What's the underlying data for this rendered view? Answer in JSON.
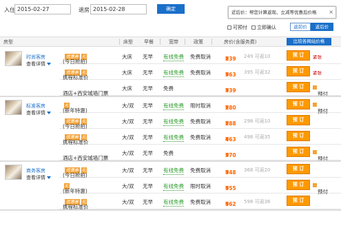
{
  "search": {
    "checkin_label": "入住",
    "checkin_value": "2015-02-27",
    "checkout_label": "退房",
    "checkout_value": "2015-02-28",
    "confirm_label": "确定"
  },
  "notice": {
    "text": "近后价：帮您计算返现、立减等优惠后价格",
    "close": "×"
  },
  "filters": {
    "prepay_label": "可预付",
    "instant_label": "立即确认"
  },
  "sort": {
    "after_label": "返后价",
    "before_label": "返前价"
  },
  "headers": {
    "room": "房型",
    "bed": "床型",
    "breakfast": "早餐",
    "broadband": "宽带",
    "policy": "政策",
    "price": "房价(含服务费)",
    "compare": "比较各网站价格"
  },
  "rooms": [
    {
      "name": "时尚客房",
      "more": "查看详情",
      "rates": [
        {
          "name": "(今日抢拍)",
          "tag": "优惠券",
          "tag2": "礼",
          "bed": "大床",
          "breakfast": "无早",
          "net": "有线免费",
          "net_free": true,
          "policy": "免费取消",
          "price": "239",
          "orig": "249 可返10",
          "book": "预 订",
          "note": "紧张"
        },
        {
          "name": "携程标准价",
          "tag": "优惠券",
          "tag2": "礼",
          "bed": "大床",
          "breakfast": "无早",
          "net": "有线免费",
          "net_free": true,
          "policy": "免费取消",
          "price": "363",
          "orig": "395 可返32",
          "book": "预 订",
          "note": "紧张"
        },
        {
          "name": "酒店+西安城墙门票",
          "tag": "",
          "tag2": "",
          "bed": "大床",
          "breakfast": "无早",
          "net": "免费",
          "net_free": false,
          "policy": "",
          "price": "339",
          "orig": "",
          "book": "预 订",
          "note": "",
          "pay": "预付"
        }
      ]
    },
    {
      "name": "标准客房",
      "more": "查看详情",
      "rates": [
        {
          "name": "(新年特惠)",
          "tag": "",
          "tag2": "礼",
          "bed": "大/双",
          "breakfast": "无早",
          "net": "有线免费",
          "net_free": true,
          "policy": "限时取消",
          "price": "280",
          "orig": "",
          "book": "预 订",
          "note": "",
          "pay": "预付"
        },
        {
          "name": "(今日抢拍)",
          "tag": "优惠券",
          "tag2": "礼",
          "bed": "大/双",
          "breakfast": "无早",
          "net": "有线免费",
          "net_free": true,
          "policy": "免费取消",
          "price": "288",
          "orig": "298 可返10",
          "book": "预 订",
          "note": ""
        },
        {
          "name": "携程标准价",
          "tag": "优惠券",
          "tag2": "礼",
          "bed": "大/双",
          "breakfast": "无早",
          "net": "有线免费",
          "net_free": true,
          "policy": "免费取消",
          "price": "463",
          "orig": "498 可返35",
          "book": "预 订",
          "note": ""
        },
        {
          "name": "酒店+西安城墙门票",
          "tag": "",
          "tag2": "",
          "bed": "大/双",
          "breakfast": "无早",
          "net": "免费",
          "net_free": false,
          "policy": "",
          "price": "370",
          "orig": "",
          "book": "预 订",
          "note": "",
          "pay": "预付"
        }
      ]
    },
    {
      "name": "商务客房",
      "more": "查看详情",
      "rates": [
        {
          "name": "(今日抢拍)",
          "tag": "优惠券",
          "tag2": "礼",
          "bed": "大/双",
          "breakfast": "无早",
          "net": "有线免费",
          "net_free": true,
          "policy": "免费取消",
          "price": "348",
          "orig": "368 可返20",
          "book": "预 订",
          "note": ""
        },
        {
          "name": "(新年特惠)",
          "tag": "",
          "tag2": "礼",
          "bed": "大/双",
          "breakfast": "无早",
          "net": "有线免费",
          "net_free": true,
          "policy": "限时取消",
          "price": "355",
          "orig": "",
          "book": "预 订",
          "note": "",
          "pay": "预付"
        },
        {
          "name": "携程标准价",
          "tag": "优惠券",
          "tag2": "礼",
          "bed": "大/双",
          "breakfast": "无早",
          "net": "有线免费",
          "net_free": true,
          "policy": "免费取消",
          "price": "562",
          "orig": "598 可返36",
          "book": "预 订",
          "note": ""
        }
      ]
    }
  ],
  "currency": "¥",
  "colors": {
    "accent": "#1a6fc9",
    "price": "#ff6600",
    "book": "#ff9900",
    "tag": "#f3a33a"
  }
}
